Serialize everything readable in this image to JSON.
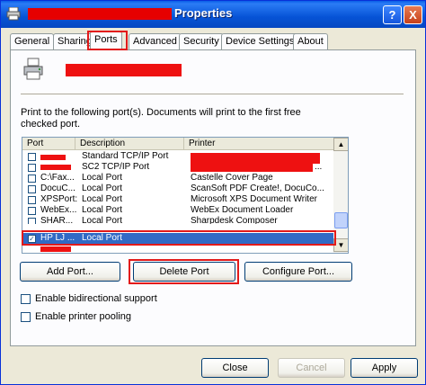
{
  "window": {
    "title": "Properties",
    "help_label": "?",
    "close_label": "X"
  },
  "tabs": [
    {
      "label": "General"
    },
    {
      "label": "Sharing"
    },
    {
      "label": "Ports",
      "active": true
    },
    {
      "label": "Advanced"
    },
    {
      "label": "Security"
    },
    {
      "label": "Device Settings"
    },
    {
      "label": "About"
    }
  ],
  "ports": {
    "instruction": "Print to the following port(s). Documents will print to the first free checked port.",
    "columns": [
      "Port",
      "Description",
      "Printer"
    ],
    "rows": [
      {
        "port": "",
        "description": "Standard TCP/IP Port",
        "printer": "",
        "checked": false
      },
      {
        "port": "",
        "description": "SC2 TCP/IP Port",
        "printer": "...",
        "checked": false
      },
      {
        "port": "C:\\Fax...",
        "description": "Local Port",
        "printer": "Castelle Cover Page",
        "checked": false
      },
      {
        "port": "DocuC...",
        "description": "Local Port",
        "printer": "ScanSoft PDF Create!, DocuCo...",
        "checked": false
      },
      {
        "port": "XPSPort:",
        "description": "Local Port",
        "printer": "Microsoft XPS Document Writer",
        "checked": false
      },
      {
        "port": "WebEx...",
        "description": "Local Port",
        "printer": "WebEx Document Loader",
        "checked": false
      },
      {
        "port": "SHAR...",
        "description": "Local Port",
        "printer": "Sharpdesk Composer",
        "checked": false
      },
      {
        "port": "HP LJ ...",
        "description": "Local Port",
        "printer": "",
        "checked": true,
        "selected": true
      }
    ]
  },
  "buttons": {
    "add_port": "Add Port...",
    "delete_port": "Delete Port",
    "configure_port": "Configure Port...",
    "close": "Close",
    "cancel": "Cancel",
    "apply": "Apply"
  },
  "options": {
    "bidirectional": "Enable bidirectional support",
    "pooling": "Enable printer pooling"
  },
  "colors": {
    "title_bar": "#0a5ee6",
    "redaction": "#ee1111",
    "selection": "#316ac5",
    "highlight_box": "#e21a1a"
  }
}
